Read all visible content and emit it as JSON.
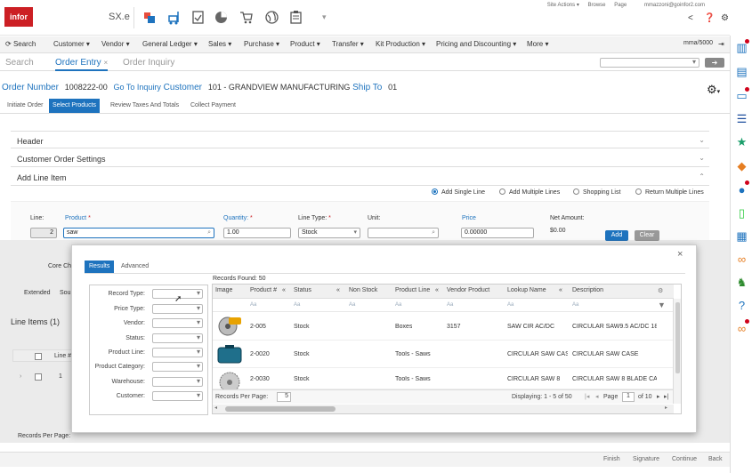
{
  "brand": {
    "logo_text": "infor",
    "app_name": "SX.e"
  },
  "top_links": [
    "Site Actions ▾",
    "Browse",
    "Page"
  ],
  "user_email": "mmazzoni@goinfor2.com",
  "menu": {
    "search": "Search",
    "items": [
      "Customer ▾",
      "Vendor ▾",
      "General Ledger ▾",
      "Sales ▾",
      "Purchase ▾",
      "Product ▾",
      "Transfer ▾",
      "Kit Production ▾",
      "Pricing and Discounting ▾",
      "More ▾"
    ],
    "user_code": "mma/5000"
  },
  "tabs": {
    "search": "Search",
    "order_entry": "Order Entry",
    "order_inquiry": "Order Inquiry",
    "close": "×",
    "go": "➔"
  },
  "order": {
    "number_label": "Order Number",
    "number": "1008222-00",
    "go_to_inquiry": "Go To Inquiry",
    "customer_label": "Customer",
    "customer": "101 - GRANDVIEW MANUFACTURING",
    "ship_to_label": "Ship To",
    "ship_to": "01"
  },
  "steps": [
    "Initiate Order",
    "Select Products",
    "Review Taxes And Totals",
    "Collect Payment"
  ],
  "sections": {
    "header": "Header",
    "customer_order_settings": "Customer Order Settings",
    "add_line_item": "Add Line Item"
  },
  "entry_modes": [
    "Add Single Line",
    "Add Multiple Lines",
    "Shopping List",
    "Return Multiple Lines"
  ],
  "line_form": {
    "line_label": "Line:",
    "line_value": "2",
    "product_label": "Product",
    "product_value": "saw",
    "quantity_label": "Quantity:",
    "quantity_value": "1.00",
    "line_type_label": "Line Type:",
    "line_type_value": "Stock",
    "unit_label": "Unit:",
    "unit_value": "",
    "price_label": "Price",
    "price_value": "0.00000",
    "net_amount_label": "Net Amount:",
    "net_amount_value": "$0.00",
    "add_button": "Add",
    "clear_button": "Clear",
    "core_label": "Core Ch",
    "extended_tab": "Extended",
    "sou_tab": "Sou"
  },
  "line_items": {
    "title": "Line Items (1)",
    "col_line": "Line #",
    "row_line": "1",
    "records_per_page": "Records Per Page:"
  },
  "modal": {
    "tabs": [
      "Results",
      "Advanced"
    ],
    "close": "×",
    "records_found": "Records Found:  50",
    "filters": [
      "Record Type:",
      "Price Type:",
      "Vendor:",
      "Status:",
      "Product Line:",
      "Product Category:",
      "Warehouse:",
      "Customer:"
    ],
    "columns": [
      "Image",
      "Product #",
      "Status",
      "Non Stock",
      "Product Line",
      "Vendor Product",
      "Lookup Name",
      "Description"
    ],
    "filter_hint": "Aa",
    "rows": [
      {
        "product": "2-005",
        "status": "Stock",
        "non_stock": "",
        "product_line": "Boxes",
        "vendor_product": "3157",
        "lookup_name": "SAW CIR AC/DC",
        "description": "CIRCULAR SAW9.5 AC/DC 18V"
      },
      {
        "product": "2-0020",
        "status": "Stock",
        "non_stock": "",
        "product_line": "Tools - Saws",
        "vendor_product": "",
        "lookup_name": "CIRCULAR SAW CASE",
        "description": "CIRCULAR SAW CASE"
      },
      {
        "product": "2-0030",
        "status": "Stock",
        "non_stock": "",
        "product_line": "Tools - Saws",
        "vendor_product": "",
        "lookup_name": "CIRCULAR SAW 8",
        "description": "CIRCULAR SAW 8 BLADE CASE"
      }
    ],
    "records_per_page_label": "Records Per Page:",
    "records_per_page": "5",
    "displaying": "Displaying:  1 - 5  of  50",
    "page_label": "Page",
    "page": "1",
    "of_pages": "of  10"
  },
  "bottom_actions": [
    "Finish",
    "Signature",
    "Continue",
    "Back"
  ],
  "colors": {
    "brand": "#cc1f24",
    "accent": "#1e73be"
  }
}
